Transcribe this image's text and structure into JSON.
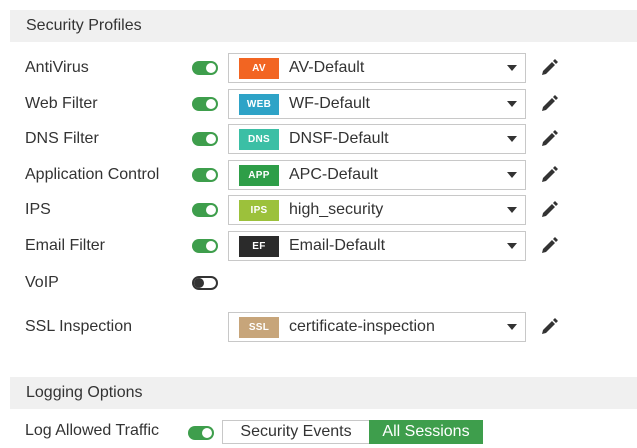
{
  "security_profiles": {
    "header": "Security Profiles",
    "rows": [
      {
        "label": "AntiVirus",
        "enabled": true,
        "badge": "AV",
        "badge_color": "#f26522",
        "value": "AV-Default"
      },
      {
        "label": "Web Filter",
        "enabled": true,
        "badge": "WEB",
        "badge_color": "#2ea3c7",
        "value": "WF-Default"
      },
      {
        "label": "DNS Filter",
        "enabled": true,
        "badge": "DNS",
        "badge_color": "#3bbfa5",
        "value": "DNSF-Default"
      },
      {
        "label": "Application Control",
        "enabled": true,
        "badge": "APP",
        "badge_color": "#2e9e48",
        "value": "APC-Default"
      },
      {
        "label": "IPS",
        "enabled": true,
        "badge": "IPS",
        "badge_color": "#9cc13b",
        "value": "high_security"
      },
      {
        "label": "Email Filter",
        "enabled": true,
        "badge": "EF",
        "badge_color": "#2b2b2b",
        "value": "Email-Default"
      },
      {
        "label": "VoIP",
        "enabled": false
      }
    ],
    "ssl": {
      "label": "SSL Inspection",
      "badge": "SSL",
      "badge_color": "#c7a57a",
      "value": "certificate-inspection"
    }
  },
  "logging": {
    "header": "Logging Options",
    "log_allowed_label": "Log Allowed Traffic",
    "log_allowed_enabled": true,
    "options": [
      "Security Events",
      "All Sessions"
    ],
    "selected": "All Sessions"
  },
  "colors": {
    "accent": "#3e9e4c"
  },
  "icons": {
    "edit": "pencil-icon",
    "dropdown": "caret-down-icon"
  }
}
